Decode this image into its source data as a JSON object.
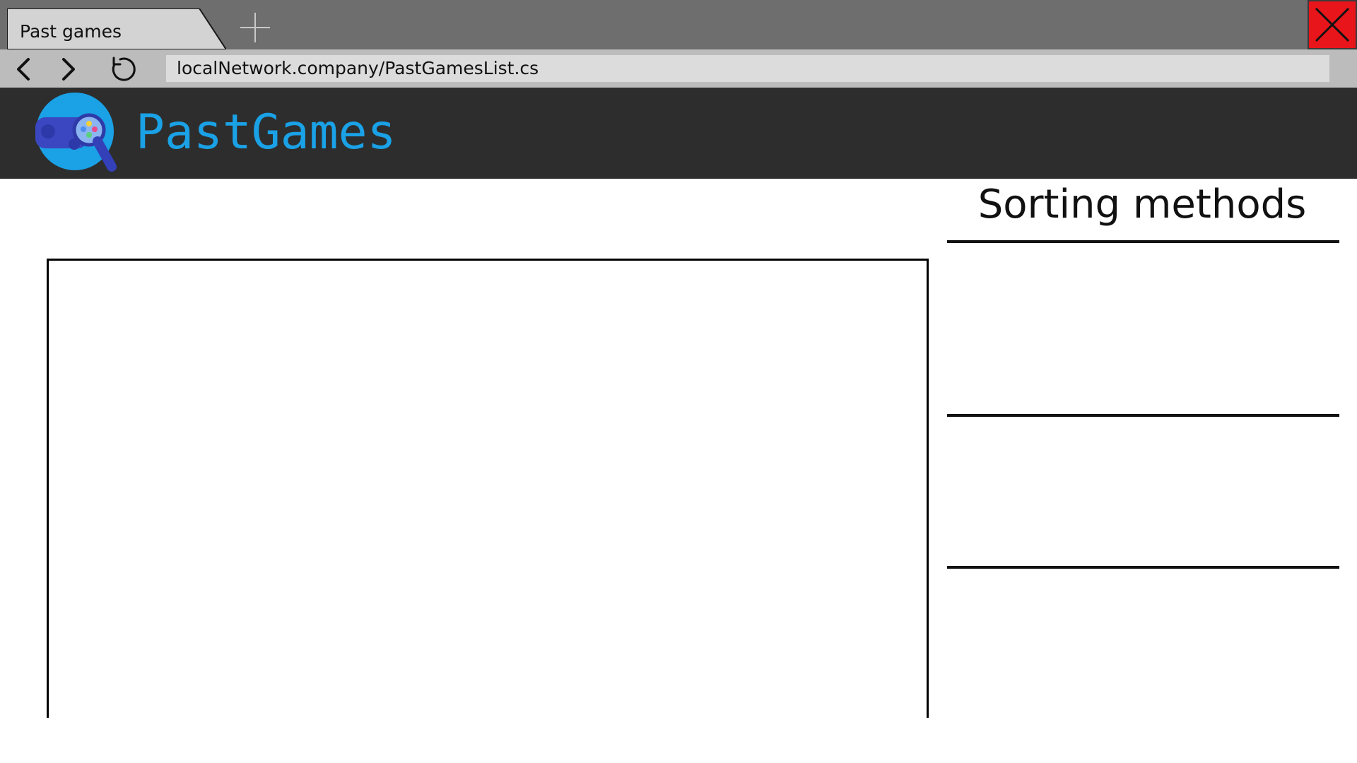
{
  "browser": {
    "tab_title": "Past games",
    "address": "localNetwork.company/PastGamesList.cs",
    "icons": {
      "new_tab": "plus-icon",
      "close": "close-icon",
      "back": "chevron-left-icon",
      "forward": "chevron-right-icon",
      "reload": "reload-icon"
    },
    "colors": {
      "chrome": "#6e6e6e",
      "tab": "#d3d3d3",
      "toolbar": "#bcbcbc",
      "address_bar": "#dcdcdc",
      "close_button": "#e8161b"
    }
  },
  "site": {
    "brand_name": "PastGames",
    "logo_icon": "gamepad-magnifier-logo",
    "colors": {
      "header": "#2d2d2d",
      "brand_text": "#1aa1e6"
    }
  },
  "sidebar": {
    "title": "Sorting methods"
  }
}
